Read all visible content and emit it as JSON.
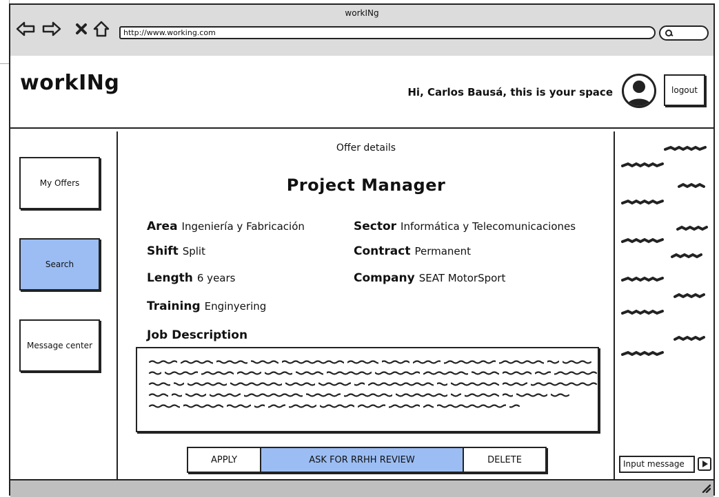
{
  "window": {
    "title": "workINg",
    "url": "http://www.working.com"
  },
  "header": {
    "logo": "workINg",
    "greeting": "Hi, Carlos Bausá, this is your space",
    "logout_label": "logout"
  },
  "sidebar": {
    "items": [
      {
        "label": "My Offers",
        "active": false
      },
      {
        "label": "Search",
        "active": true
      },
      {
        "label": "Message center",
        "active": false
      }
    ]
  },
  "main": {
    "section_title": "Offer details",
    "job_title": "Project Manager",
    "fields": {
      "area": {
        "label": "Area",
        "value": "Ingeniería y Fabricación"
      },
      "sector": {
        "label": "Sector",
        "value": "Informática y Telecomunicaciones"
      },
      "shift": {
        "label": "Shift",
        "value": "Split"
      },
      "contract": {
        "label": "Contract",
        "value": "Permanent"
      },
      "length": {
        "label": "Length",
        "value": "6 years"
      },
      "company": {
        "label": "Company",
        "value": "SEAT MotorSport"
      },
      "training": {
        "label": "Training",
        "value": "Enginyering"
      }
    },
    "job_description_label": "Job Description",
    "actions": {
      "apply": "APPLY",
      "review": "ASK FOR RRHH REVIEW",
      "delete": "DELETE"
    }
  },
  "chat": {
    "input_placeholder": "Input message"
  },
  "colors": {
    "accent": "#9bbdf3",
    "chrome": "#dcdcdc",
    "status": "#bfbfbf"
  },
  "icons": [
    "back-arrow-icon",
    "forward-arrow-icon",
    "close-icon",
    "home-icon",
    "search-icon",
    "user-avatar-icon",
    "send-icon",
    "resize-grip-icon"
  ]
}
